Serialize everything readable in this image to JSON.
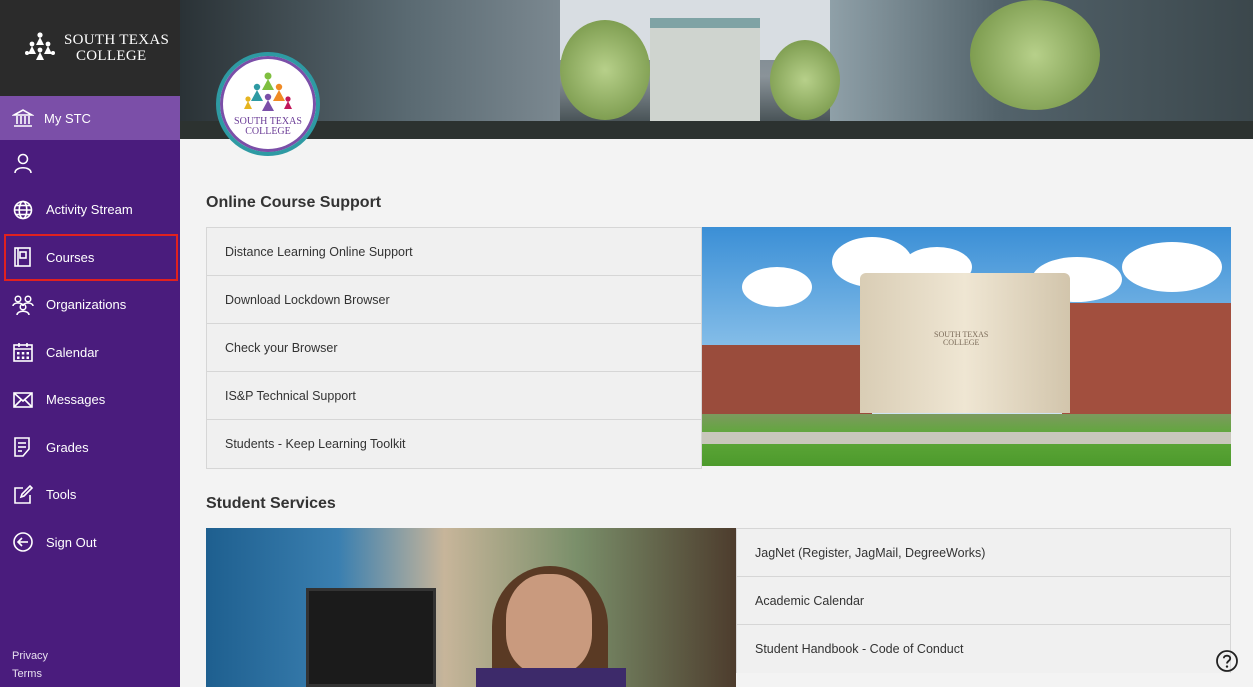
{
  "sidebar": {
    "logo_line1": "SOUTH TEXAS",
    "logo_line2": "COLLEGE",
    "mystc_label": "My STC",
    "items": [
      {
        "label": "Activity Stream"
      },
      {
        "label": "Courses"
      },
      {
        "label": "Organizations"
      },
      {
        "label": "Calendar"
      },
      {
        "label": "Messages"
      },
      {
        "label": "Grades"
      },
      {
        "label": "Tools"
      },
      {
        "label": "Sign Out"
      }
    ],
    "footer": {
      "privacy": "Privacy",
      "terms": "Terms"
    }
  },
  "hero": {
    "badge_line1": "SOUTH TEXAS",
    "badge_line2": "COLLEGE"
  },
  "online_support": {
    "title": "Online Course Support",
    "links": [
      "Distance Learning Online Support",
      "Download Lockdown Browser",
      "Check your Browser",
      "IS&P Technical Support",
      "Students - Keep Learning Toolkit"
    ],
    "image_sign_line1": "SOUTH TEXAS",
    "image_sign_line2": "COLLEGE"
  },
  "student_services": {
    "title": "Student Services",
    "links": [
      "JagNet (Register, JagMail, DegreeWorks)",
      "Academic Calendar",
      "Student Handbook - Code of Conduct"
    ]
  },
  "colors": {
    "sidebar_bg": "#4a1c7d",
    "mystc_bg": "#7b4fa8",
    "selected_outline": "#e1211f",
    "logo_bg": "#2b2b2b"
  },
  "icons": [
    "institution-icon",
    "person-icon",
    "globe-icon",
    "courses-icon",
    "organizations-icon",
    "calendar-icon",
    "envelope-icon",
    "grades-icon",
    "tools-icon",
    "sign-out-icon",
    "help-icon"
  ]
}
